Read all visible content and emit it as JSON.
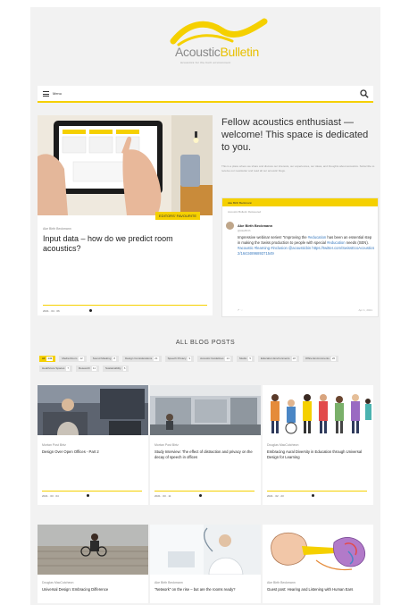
{
  "brand": {
    "name_part1": "Acoustic",
    "name_part2": "Bulletin",
    "tagline": "Acoustics for the built environment",
    "accent_color": "#f5d000"
  },
  "searchbar": {
    "menu_label": "Menu",
    "menu_icon": "hamburger-icon",
    "search_icon": "search-icon"
  },
  "featured": {
    "badge": "EDITORS' FAVOURITE",
    "author": "Ake Birth Beckmann",
    "title": "Input data – how do we predict room acoustics?",
    "date": "2021 · 04 · 06"
  },
  "welcome": {
    "heading": "Fellow acoustics enthusiast — welcome! This space is dedicated to you.",
    "text": "This is a place where we share and discuss our interests, our experiences, our ideas, and thoughts about acoustics. Subscribe to receive our newsletter and read all our acoustic blogs."
  },
  "tweet": {
    "header": "Ake Birth Beckmann",
    "retweet_note": "Acoustic Bulletin Retweeted",
    "name": "Ake Birth Beckmann",
    "handle": "@AkeBirth",
    "text_a": "Impressive webinar series! \"Improving the ",
    "link_a": "#education",
    "text_b": " has been an essential step in making the Swiss production to people with special ",
    "link_b": "#education",
    "text_c": " needs (SEN). ",
    "link_c": "#acoustic #learning #inclusion @acousticbin https://twitter.com/SwissEcoAcoustics 2/1643489689371549",
    "foot": "↱   ♡",
    "time": "Apr 1, 2021"
  },
  "all_posts": {
    "title": "ALL BLOG POSTS",
    "filters": [
      {
        "label": "All",
        "count": "143",
        "active": true
      },
      {
        "label": "Media Room",
        "count": "12"
      },
      {
        "label": "Sound Masking",
        "count": "8"
      },
      {
        "label": "Design Considerations",
        "count": "21"
      },
      {
        "label": "Speech Privacy",
        "count": "9"
      },
      {
        "label": "Acoustic Guidelines",
        "count": "14"
      },
      {
        "label": "Studio",
        "count": "5"
      },
      {
        "label": "Education Environments",
        "count": "18"
      },
      {
        "label": "Office Environments",
        "count": "26"
      },
      {
        "label": "Healthcare Spaces",
        "count": "7"
      },
      {
        "label": "Research",
        "count": "11"
      },
      {
        "label": "Sustainability",
        "count": "6"
      }
    ]
  },
  "posts": [
    {
      "author": "Mortan Post Birtz",
      "title": "Design Over Open Offices - Part 2",
      "date": "2021 · 03 · 04"
    },
    {
      "author": "Mortan Post Birtz",
      "title": "Study Interview: The effect of distraction and privacy on the decay of speech in offices",
      "date": "2021 · 03 · 11"
    },
    {
      "author": "Douglas MacCutcheon",
      "title": "Embracing Aural Diversity in Education through Universal Design for Learning",
      "date": "2021 · 02 · 23"
    },
    {
      "author": "Douglas MacCutcheon",
      "title": "Universal Design: Embracing Difference",
      "date": ""
    },
    {
      "author": "Ake Birth Beckmann",
      "title": "\"Network\" on the rise – but are the rooms ready?",
      "date": ""
    },
    {
      "author": "Ake Birth Beckmann",
      "title": "Guest post: Hearing and Listening with Human Ears",
      "date": ""
    }
  ]
}
